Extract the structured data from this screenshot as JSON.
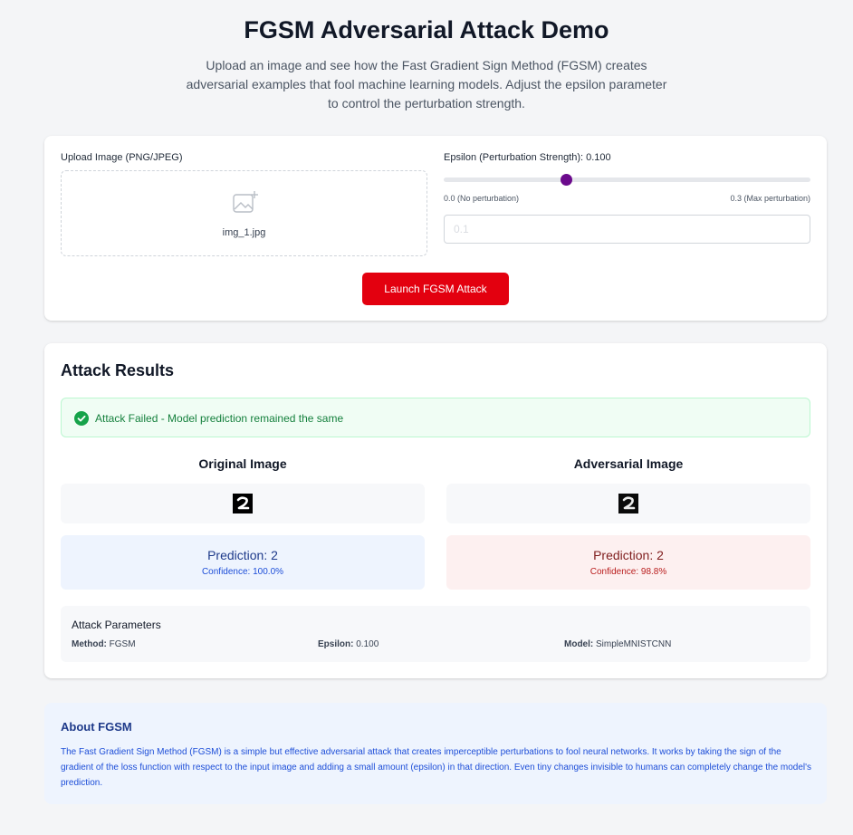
{
  "header": {
    "title": "FGSM Adversarial Attack Demo",
    "subtitle": "Upload an image and see how the Fast Gradient Sign Method (FGSM) creates adversarial examples that fool machine learning models. Adjust the epsilon parameter to control the perturbation strength."
  },
  "upload": {
    "label": "Upload Image (PNG/JPEG)",
    "file_name": "img_1.jpg",
    "icon": "image-add-icon"
  },
  "epsilon": {
    "label": "Epsilon (Perturbation Strength): 0.100",
    "value": 0.1,
    "min": 0.0,
    "max": 0.3,
    "min_label": "0.0 (No perturbation)",
    "max_label": "0.3 (Max perturbation)",
    "input_placeholder": "0.1"
  },
  "launch_button": "Launch FGSM Attack",
  "results": {
    "title": "Attack Results",
    "status": "Attack Failed - Model prediction remained the same",
    "original": {
      "title": "Original Image",
      "prediction": "Prediction: 2",
      "confidence": "Confidence: 100.0%"
    },
    "adversarial": {
      "title": "Adversarial Image",
      "prediction": "Prediction: 2",
      "confidence": "Confidence: 98.8%"
    },
    "params": {
      "title": "Attack Parameters",
      "method_label": "Method:",
      "method": "FGSM",
      "epsilon_label": "Epsilon:",
      "epsilon": "0.100",
      "model_label": "Model:",
      "model": "SimpleMNISTCNN"
    }
  },
  "about": {
    "title": "About FGSM",
    "text": "The Fast Gradient Sign Method (FGSM) is a simple but effective adversarial attack that creates imperceptible perturbations to fool neural networks. It works by taking the sign of the gradient of the loss function with respect to the input image and adding a small amount (epsilon) in that direction. Even tiny changes invisible to humans can completely change the model's prediction."
  },
  "colors": {
    "accent_button": "#e3000f",
    "slider_thumb": "#6b0a8c",
    "success": "#15803d"
  }
}
